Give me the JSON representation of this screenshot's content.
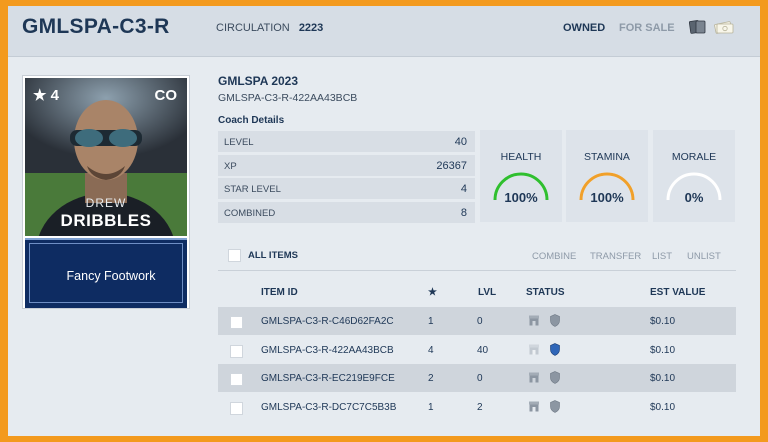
{
  "header": {
    "title": "GMLSPA-C3-R",
    "circulation_label": "CIRCULATION",
    "circulation_value": "2223",
    "owned_label": "OWNED",
    "for_sale_label": "FOR SALE"
  },
  "card": {
    "rating": "4",
    "position": "CO",
    "first_name": "DREW",
    "last_name": "DRIBBLES",
    "ability": "Fancy Footwork"
  },
  "details": {
    "set_name": "GMLSPA 2023",
    "item_id": "GMLSPA-C3-R-422AA43BCB",
    "section_title": "Coach Details",
    "rows": [
      {
        "label": "LEVEL",
        "value": "40"
      },
      {
        "label": "XP",
        "value": "26367"
      },
      {
        "label": "STAR LEVEL",
        "value": "4"
      },
      {
        "label": "COMBINED",
        "value": "8"
      }
    ]
  },
  "stats": [
    {
      "label": "HEALTH",
      "value": "100%",
      "fraction": 1.0,
      "color": "#2fbf2f"
    },
    {
      "label": "STAMINA",
      "value": "100%",
      "fraction": 1.0,
      "color": "#f0a02a"
    },
    {
      "label": "MORALE",
      "value": "0%",
      "fraction": 0.0,
      "color": "#ffffff"
    }
  ],
  "actions": {
    "all_items": "ALL ITEMS",
    "combine": "COMBINE",
    "transfer": "TRANSFER",
    "list": "LIST",
    "unlist": "UNLIST"
  },
  "table": {
    "headers": {
      "item_id": "ITEM ID",
      "star": "★",
      "lvl": "LVL",
      "status": "STATUS",
      "est_value": "EST VALUE"
    },
    "rows": [
      {
        "item_id": "GMLSPA-C3-R-C46D62FA2C",
        "star": "1",
        "lvl": "0",
        "est_value": "$0.10",
        "active": false
      },
      {
        "item_id": "GMLSPA-C3-R-422AA43BCB",
        "star": "4",
        "lvl": "40",
        "est_value": "$0.10",
        "active": true
      },
      {
        "item_id": "GMLSPA-C3-R-EC219E9FCE",
        "star": "2",
        "lvl": "0",
        "est_value": "$0.10",
        "active": false
      },
      {
        "item_id": "GMLSPA-C3-R-DC7C7C5B3B",
        "star": "1",
        "lvl": "2",
        "est_value": "$0.10",
        "active": false
      }
    ]
  },
  "icons": [
    "cards-icon",
    "cash-icon",
    "star-icon",
    "store-icon",
    "shield-icon"
  ]
}
